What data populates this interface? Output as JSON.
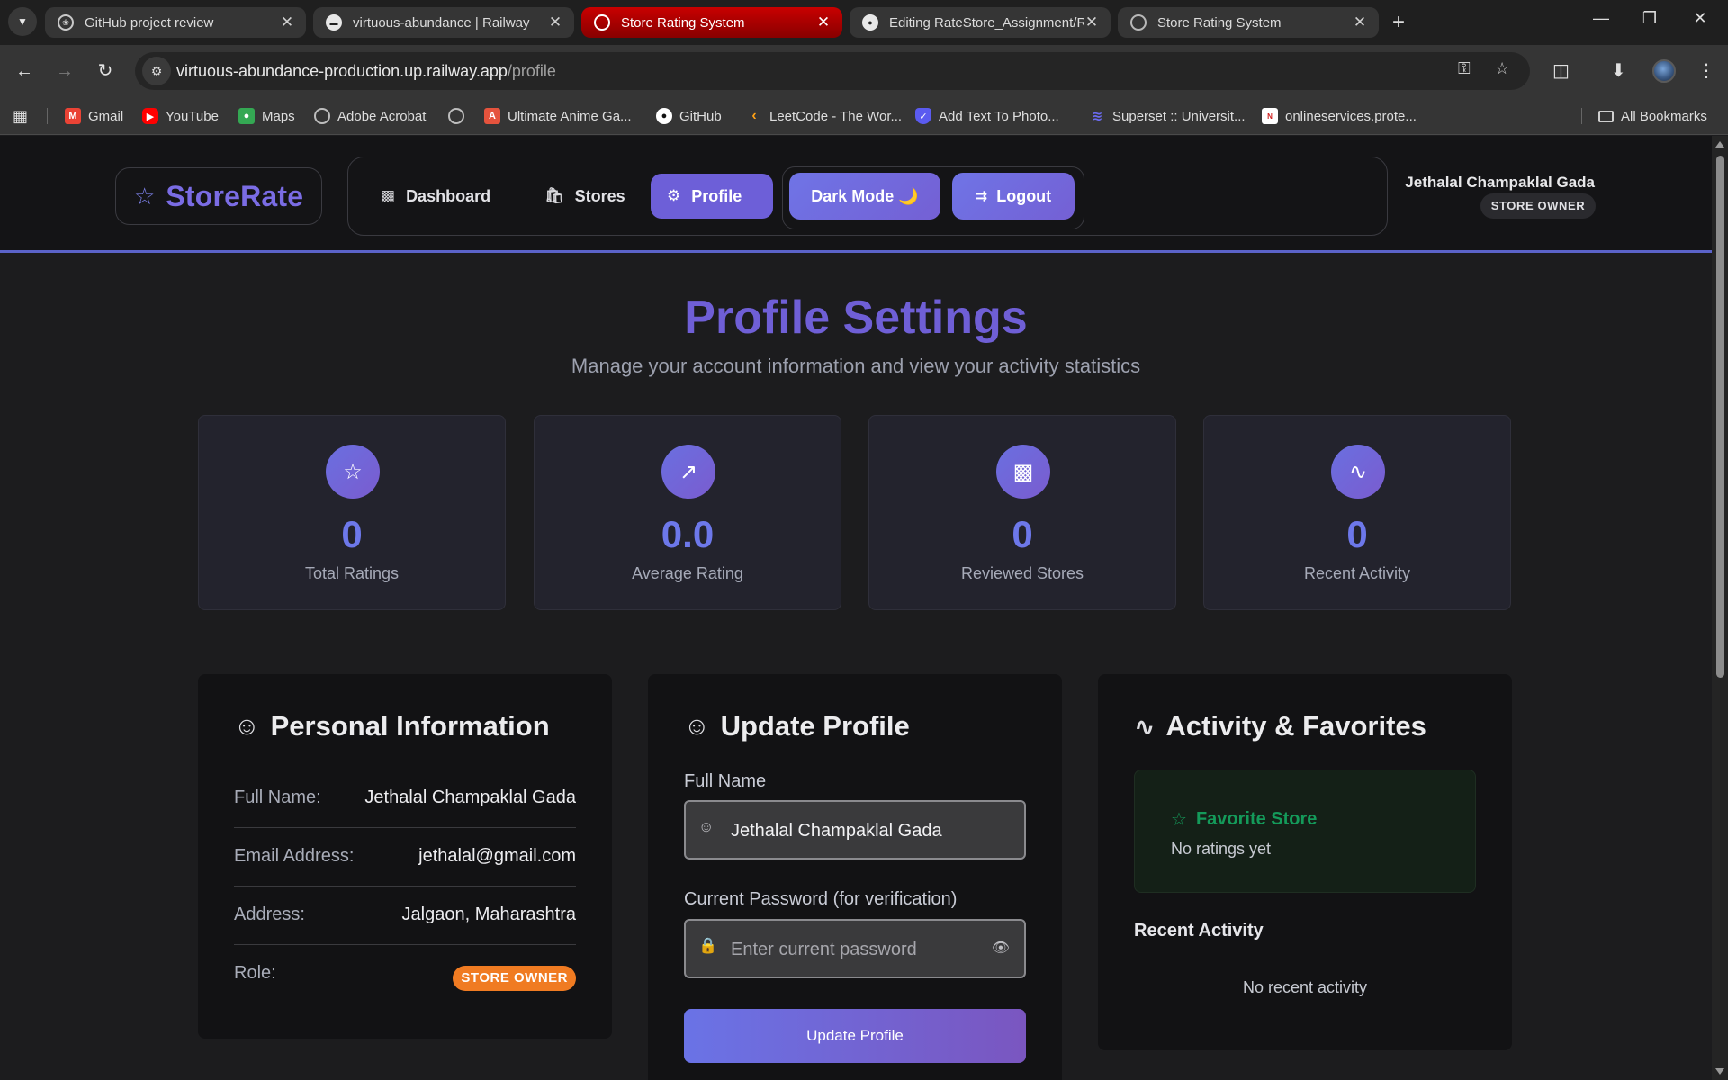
{
  "browser": {
    "tabs": [
      {
        "title": "GitHub project review",
        "icon": "openai-icon",
        "active": false
      },
      {
        "title": "virtuous-abundance | Railway",
        "icon": "railway-icon",
        "active": false
      },
      {
        "title": "Store Rating System",
        "icon": "globe-icon",
        "active": true
      },
      {
        "title": "Editing RateStore_Assignment/R",
        "icon": "github-icon",
        "active": false
      },
      {
        "title": "Store Rating System",
        "icon": "globe-icon",
        "active": false
      }
    ],
    "url_host": "virtuous-abundance-production.up.railway.app",
    "url_path": "/profile",
    "bookmarks": [
      {
        "label": "Gmail",
        "icon": "gmail-icon",
        "color": "#ea4335"
      },
      {
        "label": "YouTube",
        "icon": "youtube-icon",
        "color": "#ff0000"
      },
      {
        "label": "Maps",
        "icon": "maps-icon",
        "color": "#34a853"
      },
      {
        "label": "Adobe Acrobat",
        "icon": "globe-icon",
        "color": "#9e9e9e"
      },
      {
        "label": "",
        "icon": "globe-icon",
        "color": "#9e9e9e"
      },
      {
        "label": "Ultimate Anime Ga...",
        "icon": "anime-icon",
        "color": "#e5533d"
      },
      {
        "label": "GitHub",
        "icon": "github-icon",
        "color": "#ffffff"
      },
      {
        "label": "LeetCode - The Wor...",
        "icon": "leetcode-icon",
        "color": "#ffa116"
      },
      {
        "label": "Add Text To Photo...",
        "icon": "shield-icon",
        "color": "#5b5bf0"
      },
      {
        "label": "Superset :: Universit...",
        "icon": "superset-icon",
        "color": "#6b6bf0"
      },
      {
        "label": "onlineservices.prote...",
        "icon": "nsdl-icon",
        "color": "#d02020"
      }
    ],
    "all_bookmarks": "All Bookmarks"
  },
  "app": {
    "brand": "StoreRate",
    "nav": {
      "dashboard": "Dashboard",
      "stores": "Stores",
      "profile": "Profile"
    },
    "dark_mode": "Dark Mode 🌙",
    "logout": "Logout",
    "user_name": "Jethalal Champaklal Gada",
    "user_role": "STORE OWNER"
  },
  "page": {
    "title": "Profile Settings",
    "subtitle": "Manage your account information and view your activity statistics"
  },
  "stats": [
    {
      "value": "0",
      "label": "Total Ratings",
      "icon": "star-icon"
    },
    {
      "value": "0.0",
      "label": "Average Rating",
      "icon": "trending-up-icon"
    },
    {
      "value": "0",
      "label": "Reviewed Stores",
      "icon": "bar-chart-icon"
    },
    {
      "value": "0",
      "label": "Recent Activity",
      "icon": "activity-icon"
    }
  ],
  "personal": {
    "title": "Personal Information",
    "rows": [
      {
        "label": "Full Name:",
        "value": "Jethalal Champaklal Gada"
      },
      {
        "label": "Email Address:",
        "value": "jethalal@gmail.com"
      },
      {
        "label": "Address:",
        "value": "Jalgaon, Maharashtra"
      }
    ],
    "role_label": "Role:",
    "role_value": "STORE OWNER"
  },
  "update": {
    "title": "Update Profile",
    "name_label": "Full Name",
    "name_value": "Jethalal Champaklal Gada",
    "password_label": "Current Password (for verification)",
    "password_placeholder": "Enter current password",
    "submit": "Update Profile"
  },
  "activity": {
    "title": "Activity & Favorites",
    "favorite_title": "Favorite Store",
    "favorite_text": "No ratings yet",
    "recent_title": "Recent Activity",
    "recent_empty": "No recent activity"
  },
  "colors": {
    "accent": "#6f5fd6",
    "role_badge": "#f07b22",
    "favorite": "#149a5a"
  }
}
